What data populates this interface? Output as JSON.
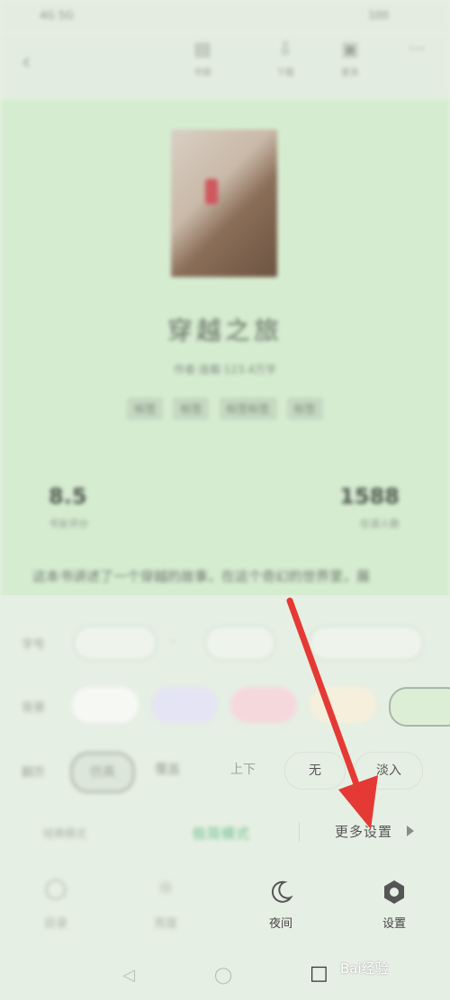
{
  "status": {
    "left": "4G 5G",
    "right": "100"
  },
  "topbar": {
    "items": [
      {
        "label": "书架",
        "icon": "notes-icon"
      },
      {
        "label": "下载",
        "icon": "download-icon"
      },
      {
        "label": "更多",
        "icon": "more-icon"
      },
      {
        "label": "···",
        "icon": "dots-icon"
      }
    ]
  },
  "book": {
    "title": "穿越之旅",
    "meta": "作者·连载·123.4万字",
    "tags": [
      "标签",
      "标签",
      "标签标签",
      "标签"
    ],
    "rating": "8.5",
    "rating_label": "书友评分",
    "readers": "1588",
    "readers_label": "在读人数",
    "intro": "这本书讲述了一个穿越的故事，在这个奇幻的世界里，展"
  },
  "settings": {
    "font_label": "字号",
    "bg_label": "背景",
    "anim_label": "翻页",
    "anim_options": [
      "仿真",
      "覆盖",
      "上下",
      "无",
      "淡入"
    ],
    "mode_left": "经典模式",
    "mode_mid": "极简模式",
    "mode_more": "更多设置"
  },
  "bottom": {
    "items": [
      {
        "label": "目录",
        "icon": "catalog-icon"
      },
      {
        "label": "亮度",
        "icon": "brightness-icon"
      },
      {
        "label": "夜间",
        "icon": "moon-icon"
      },
      {
        "label": "设置",
        "icon": "gear-icon"
      }
    ]
  },
  "watermark": "Bai经验",
  "colors": {
    "accent_green": "#6cc18d",
    "arrow_red": "#e53935",
    "book_bg": "#d6ecd1"
  }
}
